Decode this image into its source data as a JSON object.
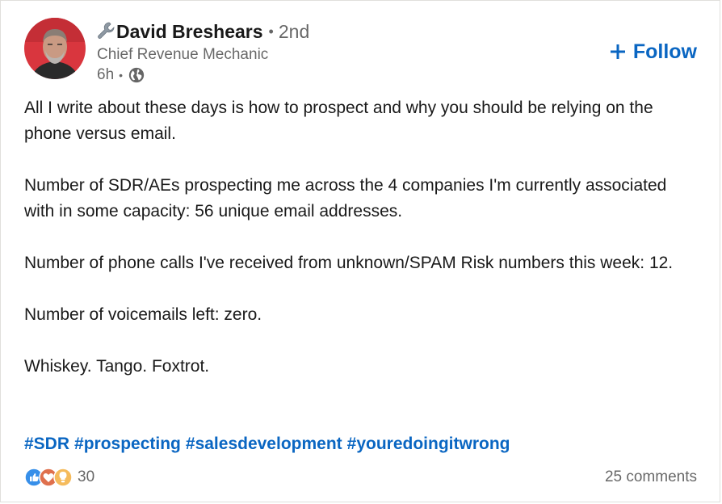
{
  "author": {
    "emoji_icon": "wrench-icon",
    "name": "David Breshears",
    "degree": "2nd",
    "headline": "Chief Revenue Mechanic",
    "time": "6h",
    "visibility_icon": "globe-icon"
  },
  "follow_button": {
    "label": "Follow",
    "icon": "plus-icon"
  },
  "post": {
    "paragraphs": [
      "All I write about these days is how to prospect and why you should be relying on the phone versus email.",
      "Number of SDR/AEs prospecting me across the 4 companies I'm currently associated with in some capacity: 56 unique email addresses.",
      "Number of phone calls I've received from unknown/SPAM Risk numbers this week: 12.",
      "Number of voicemails left: zero.",
      "Whiskey. Tango. Foxtrot."
    ],
    "hashtags": [
      "#SDR",
      "#prospecting",
      "#salesdevelopment",
      "#youredoingitwrong"
    ]
  },
  "social": {
    "reaction_icons": [
      "like-icon",
      "love-icon",
      "insightful-icon"
    ],
    "reaction_count": "30",
    "comments": "25 comments"
  },
  "colors": {
    "link": "#0a66c2",
    "muted": "#666666"
  }
}
